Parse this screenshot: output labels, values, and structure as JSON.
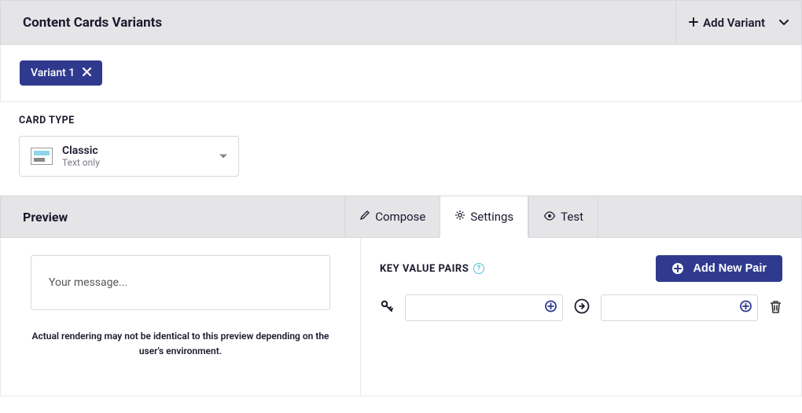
{
  "header": {
    "title": "Content Cards Variants",
    "add_variant_label": "Add Variant"
  },
  "variants": [
    {
      "label": "Variant 1"
    }
  ],
  "card_type": {
    "section_label": "CARD TYPE",
    "selected": {
      "name": "Classic",
      "description": "Text only"
    }
  },
  "preview": {
    "label": "Preview",
    "message_placeholder": "Your message...",
    "note": "Actual rendering may not be identical to this preview depending on the user's environment."
  },
  "tabs": {
    "compose": "Compose",
    "settings": "Settings",
    "test": "Test",
    "active": "settings"
  },
  "settings_panel": {
    "kvp_label": "KEY VALUE PAIRS",
    "add_pair_label": "Add New Pair",
    "pairs": [
      {
        "key": "",
        "value": ""
      }
    ]
  }
}
